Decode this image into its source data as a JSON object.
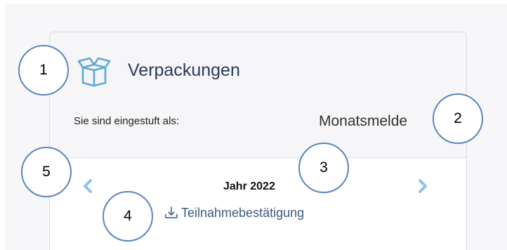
{
  "card": {
    "title": "Verpackungen",
    "icon": "box-open-icon",
    "classification": {
      "label": "Sie sind eingestuft als:",
      "value": "Monatsmelde"
    }
  },
  "period": {
    "year_label": "Jahr 2022",
    "prev_icon": "chevron-left-icon",
    "next_icon": "chevron-right-icon"
  },
  "download": {
    "label": "Teilnahmebestätigung",
    "icon": "download-icon"
  },
  "markers": [
    "1",
    "2",
    "3",
    "4",
    "5"
  ],
  "colors": {
    "accent": "#5fa8d3",
    "title_text": "#2a3a5e",
    "link_text": "#3c5a7d",
    "marker_border": "#5b86b9"
  }
}
